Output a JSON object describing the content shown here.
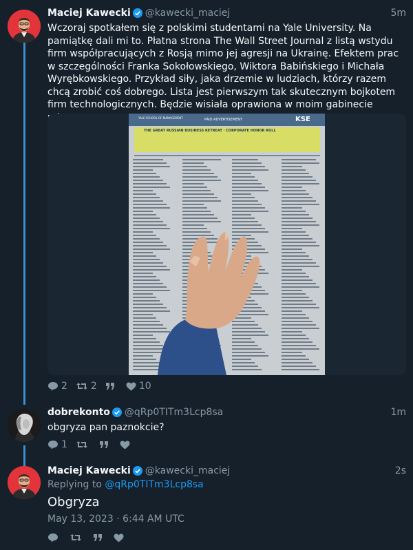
{
  "tweets": [
    {
      "author": "Maciej Kawecki",
      "handle": "@kawecki_maciej",
      "time": "5m",
      "text": "Wczoraj spotkałem się z polskimi studentami na Yale University. Na pamiątkę dali mi to. Płatna strona The Wall Street Journal z listą wstydu firm współpracujących z Rosją mimo jej agresji na Ukrainę. Efektem prac w szczególności Franka Sokołowskiego, Wiktora Babińskiego i Michała Wyrębkowskiego. Przykład siły, jaka drzemie w ludziach, którzy razem chcą zrobić coś dobrego. Lista jest pierwszym tak skutecznym bojkotem firm technologicznych. Będzie wisiała oprawiona w moim gabinecie rektora.",
      "media": {
        "logo_left": "YALE SCHOOL OF MANAGEMENT",
        "center_label": "PAID ADVERTISEMENT",
        "logo_right": "KSE",
        "headline": "THE GREAT RUSSIAN BUSINESS RETREAT · CORPORATE HONOR ROLL"
      },
      "replies": "2",
      "retweets": "2",
      "likes": "10"
    },
    {
      "author": "dobrekonto",
      "handle": "@qRp0TITm3Lcp8sa",
      "time": "1m",
      "text": "obgryza pan paznokcie?",
      "replies": "1"
    },
    {
      "author": "Maciej Kawecki",
      "handle": "@kawecki_maciej",
      "time": "2s",
      "replying_prefix": "Replying to",
      "replying_to": "@qRp0TITm3Lcp8sa",
      "text": "Obgryza",
      "date": "May 13, 2023 · 6:44 AM UTC"
    }
  ],
  "colors": {
    "background": "#15202b",
    "thread_line": "#3a8fd6",
    "muted": "#8899a6",
    "link": "#1d9bf0",
    "verified": "#1d9bf0"
  },
  "icons": [
    "reply-icon",
    "retweet-icon",
    "quote-icon",
    "like-icon",
    "verified-icon"
  ]
}
